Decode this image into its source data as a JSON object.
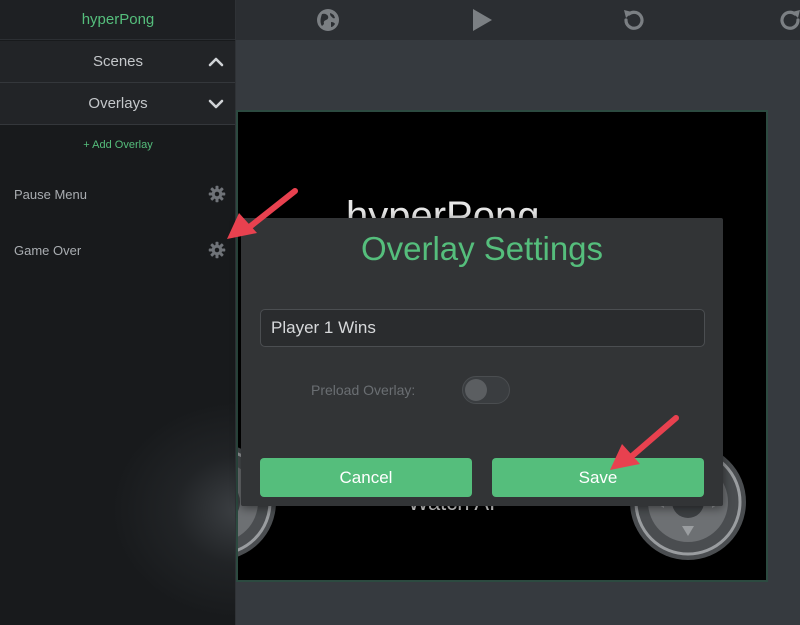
{
  "app": {
    "title": "hyperPong"
  },
  "sidebar": {
    "sections": [
      {
        "label": "Scenes",
        "state": "collapsed"
      },
      {
        "label": "Overlays",
        "state": "expanded"
      }
    ],
    "add_overlay_label": "+ Add Overlay",
    "overlays": [
      {
        "label": "Pause Menu"
      },
      {
        "label": "Game Over"
      }
    ]
  },
  "toolbar": {
    "icons": [
      "globe-icon",
      "play-icon",
      "undo-icon",
      "refresh-icon"
    ]
  },
  "game": {
    "title": "hyperPong",
    "subtitle": "Watch AI"
  },
  "modal": {
    "title": "Overlay Settings",
    "name_value": "Player 1 Wins",
    "preload_label": "Preload Overlay:",
    "preload_enabled": false,
    "cancel_label": "Cancel",
    "save_label": "Save"
  },
  "colors": {
    "accent": "#55be7c",
    "annotation": "#e8414f"
  }
}
